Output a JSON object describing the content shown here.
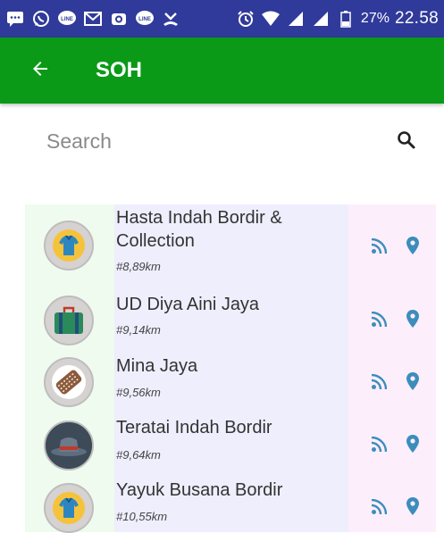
{
  "status_bar": {
    "battery_percent": "27%",
    "time": "22.58",
    "notification_icons": [
      "message-icon",
      "whatsapp-icon",
      "line-icon",
      "gmail-icon",
      "camera-icon",
      "line-icon",
      "missed-call-icon"
    ],
    "system_icons": [
      "alarm-icon",
      "wifi-icon",
      "signal-icon",
      "signal-icon",
      "battery-icon"
    ]
  },
  "app_bar": {
    "back_icon": "arrow-left-icon",
    "title": "SOH",
    "color": "#0a9a17"
  },
  "search": {
    "placeholder": "Search",
    "value": "",
    "icon": "search-icon"
  },
  "list": {
    "items": [
      {
        "name": "Hasta Indah Bordir & Collection",
        "distance": "#8,89km",
        "avatar": "shirt-icon"
      },
      {
        "name": "UD Diya Aini Jaya",
        "distance": "#9,14km",
        "avatar": "suitcase-icon"
      },
      {
        "name": "Mina Jaya",
        "distance": "#9,56km",
        "avatar": "fabric-icon"
      },
      {
        "name": "Teratai Indah Bordir",
        "distance": "#9,64km",
        "avatar": "hat-icon"
      },
      {
        "name": "Yayuk Busana Bordir",
        "distance": "#10,55km",
        "avatar": "shirt-icon"
      }
    ],
    "row_actions": [
      "rss-feed-icon",
      "location-pin-icon"
    ],
    "action_color": "#3c8dbc"
  }
}
